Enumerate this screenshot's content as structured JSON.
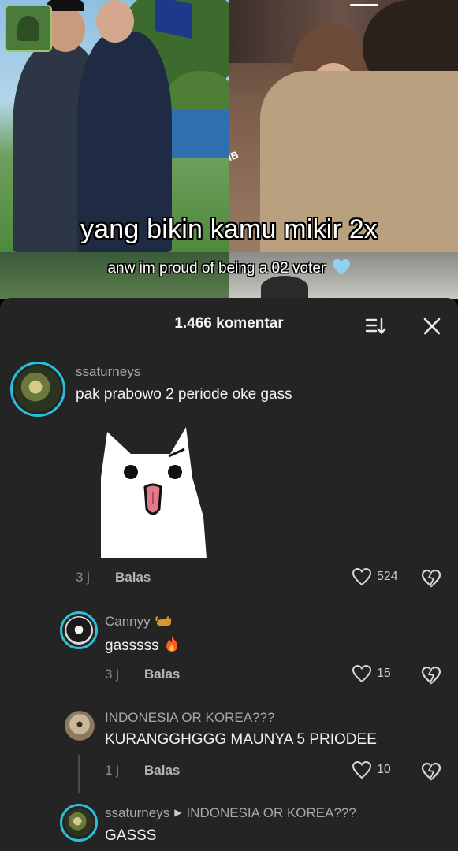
{
  "video": {
    "caption_main": "yang bikin kamu mikir 2x",
    "caption_sub": "anw im proud of being a 02 voter",
    "caption_sub_emoji": "light-blue-heart",
    "watermark_text": "IB"
  },
  "comments_sheet": {
    "title": "1.466 komentar",
    "sort_icon": "sort-icon",
    "close_icon": "close-icon",
    "comments": [
      {
        "username": "ssaturneys",
        "text": "pak prabowo 2 periode oke gass",
        "sticker": "white-cat-tongue-out",
        "time": "3 j",
        "reply_label": "Balas",
        "likes": "524"
      }
    ],
    "replies": [
      {
        "username": "Cannyy",
        "username_emoji": "cat-emoji",
        "text": "gasssss",
        "text_emoji": "fire-emoji",
        "time": "3 j",
        "reply_label": "Balas",
        "likes": "15"
      },
      {
        "username": "INDONESIA OR KOREA???",
        "text": "KURANGGHGGG MAUNYA 5 PRIODEE",
        "time": "1 j",
        "reply_label": "Balas",
        "likes": "10"
      },
      {
        "username": "ssaturneys",
        "reply_to": "INDONESIA OR KOREA???",
        "text": "GASSS"
      }
    ]
  },
  "colors": {
    "sheet_bg": "#242424",
    "avatar_ring": "#27c1d9",
    "muted_text": "#a8a8a8"
  }
}
